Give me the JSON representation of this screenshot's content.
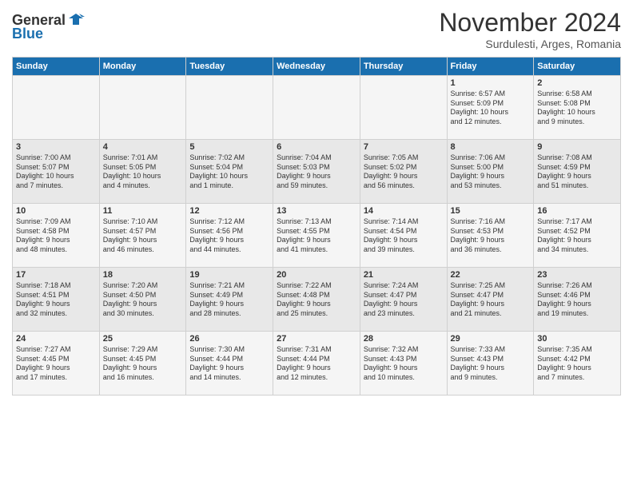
{
  "header": {
    "logo_line1": "General",
    "logo_line2": "Blue",
    "month_title": "November 2024",
    "subtitle": "Surdulesti, Arges, Romania"
  },
  "weekdays": [
    "Sunday",
    "Monday",
    "Tuesday",
    "Wednesday",
    "Thursday",
    "Friday",
    "Saturday"
  ],
  "weeks": [
    [
      {
        "day": "",
        "info": ""
      },
      {
        "day": "",
        "info": ""
      },
      {
        "day": "",
        "info": ""
      },
      {
        "day": "",
        "info": ""
      },
      {
        "day": "",
        "info": ""
      },
      {
        "day": "1",
        "info": "Sunrise: 6:57 AM\nSunset: 5:09 PM\nDaylight: 10 hours\nand 12 minutes."
      },
      {
        "day": "2",
        "info": "Sunrise: 6:58 AM\nSunset: 5:08 PM\nDaylight: 10 hours\nand 9 minutes."
      }
    ],
    [
      {
        "day": "3",
        "info": "Sunrise: 7:00 AM\nSunset: 5:07 PM\nDaylight: 10 hours\nand 7 minutes."
      },
      {
        "day": "4",
        "info": "Sunrise: 7:01 AM\nSunset: 5:05 PM\nDaylight: 10 hours\nand 4 minutes."
      },
      {
        "day": "5",
        "info": "Sunrise: 7:02 AM\nSunset: 5:04 PM\nDaylight: 10 hours\nand 1 minute."
      },
      {
        "day": "6",
        "info": "Sunrise: 7:04 AM\nSunset: 5:03 PM\nDaylight: 9 hours\nand 59 minutes."
      },
      {
        "day": "7",
        "info": "Sunrise: 7:05 AM\nSunset: 5:02 PM\nDaylight: 9 hours\nand 56 minutes."
      },
      {
        "day": "8",
        "info": "Sunrise: 7:06 AM\nSunset: 5:00 PM\nDaylight: 9 hours\nand 53 minutes."
      },
      {
        "day": "9",
        "info": "Sunrise: 7:08 AM\nSunset: 4:59 PM\nDaylight: 9 hours\nand 51 minutes."
      }
    ],
    [
      {
        "day": "10",
        "info": "Sunrise: 7:09 AM\nSunset: 4:58 PM\nDaylight: 9 hours\nand 48 minutes."
      },
      {
        "day": "11",
        "info": "Sunrise: 7:10 AM\nSunset: 4:57 PM\nDaylight: 9 hours\nand 46 minutes."
      },
      {
        "day": "12",
        "info": "Sunrise: 7:12 AM\nSunset: 4:56 PM\nDaylight: 9 hours\nand 44 minutes."
      },
      {
        "day": "13",
        "info": "Sunrise: 7:13 AM\nSunset: 4:55 PM\nDaylight: 9 hours\nand 41 minutes."
      },
      {
        "day": "14",
        "info": "Sunrise: 7:14 AM\nSunset: 4:54 PM\nDaylight: 9 hours\nand 39 minutes."
      },
      {
        "day": "15",
        "info": "Sunrise: 7:16 AM\nSunset: 4:53 PM\nDaylight: 9 hours\nand 36 minutes."
      },
      {
        "day": "16",
        "info": "Sunrise: 7:17 AM\nSunset: 4:52 PM\nDaylight: 9 hours\nand 34 minutes."
      }
    ],
    [
      {
        "day": "17",
        "info": "Sunrise: 7:18 AM\nSunset: 4:51 PM\nDaylight: 9 hours\nand 32 minutes."
      },
      {
        "day": "18",
        "info": "Sunrise: 7:20 AM\nSunset: 4:50 PM\nDaylight: 9 hours\nand 30 minutes."
      },
      {
        "day": "19",
        "info": "Sunrise: 7:21 AM\nSunset: 4:49 PM\nDaylight: 9 hours\nand 28 minutes."
      },
      {
        "day": "20",
        "info": "Sunrise: 7:22 AM\nSunset: 4:48 PM\nDaylight: 9 hours\nand 25 minutes."
      },
      {
        "day": "21",
        "info": "Sunrise: 7:24 AM\nSunset: 4:47 PM\nDaylight: 9 hours\nand 23 minutes."
      },
      {
        "day": "22",
        "info": "Sunrise: 7:25 AM\nSunset: 4:47 PM\nDaylight: 9 hours\nand 21 minutes."
      },
      {
        "day": "23",
        "info": "Sunrise: 7:26 AM\nSunset: 4:46 PM\nDaylight: 9 hours\nand 19 minutes."
      }
    ],
    [
      {
        "day": "24",
        "info": "Sunrise: 7:27 AM\nSunset: 4:45 PM\nDaylight: 9 hours\nand 17 minutes."
      },
      {
        "day": "25",
        "info": "Sunrise: 7:29 AM\nSunset: 4:45 PM\nDaylight: 9 hours\nand 16 minutes."
      },
      {
        "day": "26",
        "info": "Sunrise: 7:30 AM\nSunset: 4:44 PM\nDaylight: 9 hours\nand 14 minutes."
      },
      {
        "day": "27",
        "info": "Sunrise: 7:31 AM\nSunset: 4:44 PM\nDaylight: 9 hours\nand 12 minutes."
      },
      {
        "day": "28",
        "info": "Sunrise: 7:32 AM\nSunset: 4:43 PM\nDaylight: 9 hours\nand 10 minutes."
      },
      {
        "day": "29",
        "info": "Sunrise: 7:33 AM\nSunset: 4:43 PM\nDaylight: 9 hours\nand 9 minutes."
      },
      {
        "day": "30",
        "info": "Sunrise: 7:35 AM\nSunset: 4:42 PM\nDaylight: 9 hours\nand 7 minutes."
      }
    ]
  ]
}
